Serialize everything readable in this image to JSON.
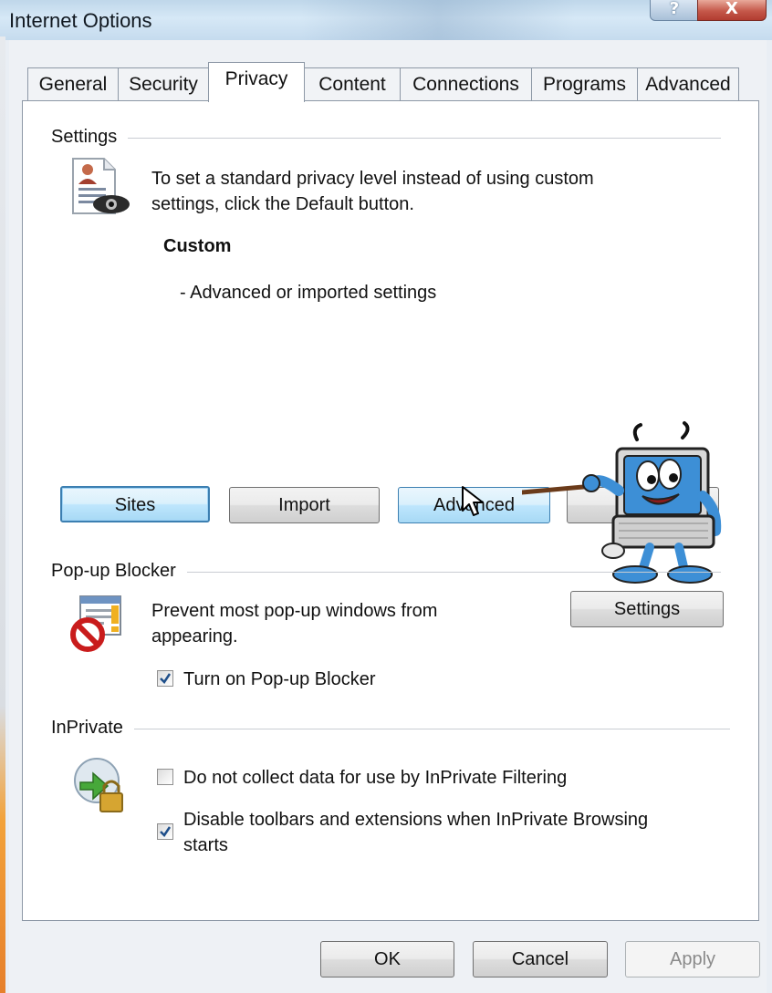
{
  "window": {
    "title": "Internet Options",
    "help_label": "?",
    "close_label": "X"
  },
  "tabs": [
    {
      "label": "General"
    },
    {
      "label": "Security"
    },
    {
      "label": "Privacy"
    },
    {
      "label": "Content"
    },
    {
      "label": "Connections"
    },
    {
      "label": "Programs"
    },
    {
      "label": "Advanced"
    }
  ],
  "active_tab": "Privacy",
  "settings": {
    "group_label": "Settings",
    "description_line1": "To set a standard privacy level instead of using custom",
    "description_line2": "settings, click the Default button.",
    "level_title": "Custom",
    "level_detail": "- Advanced or imported settings",
    "buttons": {
      "sites": "Sites",
      "import": "Import",
      "advanced": "Advanced"
    }
  },
  "popup_blocker": {
    "group_label": "Pop-up Blocker",
    "description_line1": "Prevent most pop-up windows from",
    "description_line2": "appearing.",
    "settings_button": "Settings",
    "checkbox_label": "Turn on Pop-up Blocker",
    "checkbox_checked": true
  },
  "inprivate": {
    "group_label": "InPrivate",
    "option1_label": "Do not collect data for use by InPrivate Filtering",
    "option1_checked": false,
    "option2_line1": "Disable toolbars and extensions when InPrivate Browsing",
    "option2_line2": "starts",
    "option2_checked": true
  },
  "footer": {
    "ok": "OK",
    "cancel": "Cancel",
    "apply": "Apply"
  },
  "colors": {
    "accent": "#3c7fb1",
    "titlebar": "#c5dbee",
    "close": "#c5584a"
  }
}
